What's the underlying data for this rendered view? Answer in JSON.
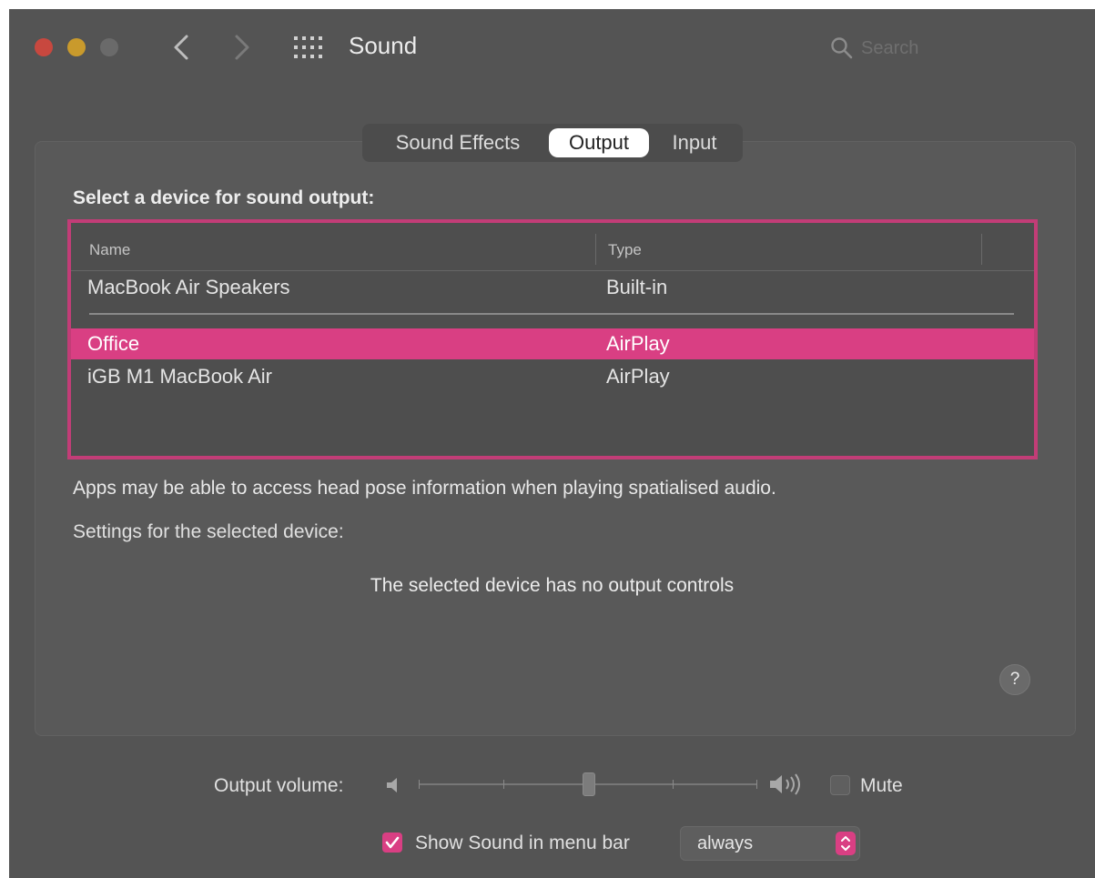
{
  "window": {
    "title": "Sound"
  },
  "search": {
    "placeholder": "Search"
  },
  "tabs": [
    {
      "label": "Sound Effects",
      "selected": false
    },
    {
      "label": "Output",
      "selected": true
    },
    {
      "label": "Input",
      "selected": false
    }
  ],
  "output": {
    "heading": "Select a device for sound output:",
    "columns": {
      "name": "Name",
      "type": "Type"
    },
    "devices": [
      {
        "name": "MacBook Air Speakers",
        "type": "Built-in",
        "selected": false
      },
      {
        "name": "Office",
        "type": "AirPlay",
        "selected": true
      },
      {
        "name": "iGB M1 MacBook Air",
        "type": "AirPlay",
        "selected": false
      }
    ],
    "note": "Apps may be able to access head pose information when playing spatialised audio.",
    "settings_label": "Settings for the selected device:",
    "no_controls": "The selected device has no output controls"
  },
  "help": {
    "label": "?"
  },
  "volume": {
    "label": "Output volume:",
    "level": 0.5,
    "mute_label": "Mute",
    "muted": false
  },
  "menubar": {
    "show_label": "Show Sound in menu bar",
    "checked": true,
    "mode": "always"
  },
  "colors": {
    "accent": "#d93f83",
    "selection_border": "#c23d77",
    "window_bg": "#545454"
  }
}
